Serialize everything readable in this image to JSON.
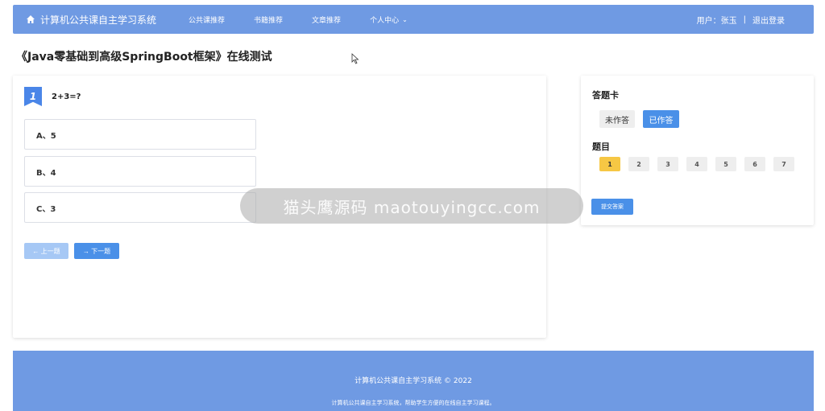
{
  "nav": {
    "brand": "计算机公共课自主学习系统",
    "items": [
      "公共课推荐",
      "书籍推荐",
      "文章推荐",
      "个人中心"
    ],
    "user_label": "用户：张玉",
    "separator": "|",
    "logout": "退出登录"
  },
  "page_title": "《Java零基础到高级SpringBoot框架》在线测试",
  "question": {
    "number": "1",
    "text": "2+3=?",
    "options": [
      "A、5",
      "B、4",
      "C、3"
    ],
    "prev_label": "← 上一题",
    "next_label": "→ 下一题"
  },
  "answer_card": {
    "title": "答题卡",
    "legend_unanswered": "未作答",
    "legend_answered": "已作答",
    "questions_label": "题目",
    "numbers": [
      "1",
      "2",
      "3",
      "4",
      "5",
      "6",
      "7"
    ],
    "submit_label": "提交答案"
  },
  "watermark": "猫头鹰源码 maotouyingcc.com",
  "footer": {
    "line1": "计算机公共课自主学习系统 © 2022",
    "line2": "计算机公共课自主学习系统，帮助学生方便的在线自主学习课程。"
  },
  "colors": {
    "primary": "#6f9ae3",
    "accent": "#4a90e8",
    "current_question": "#f6c744"
  }
}
